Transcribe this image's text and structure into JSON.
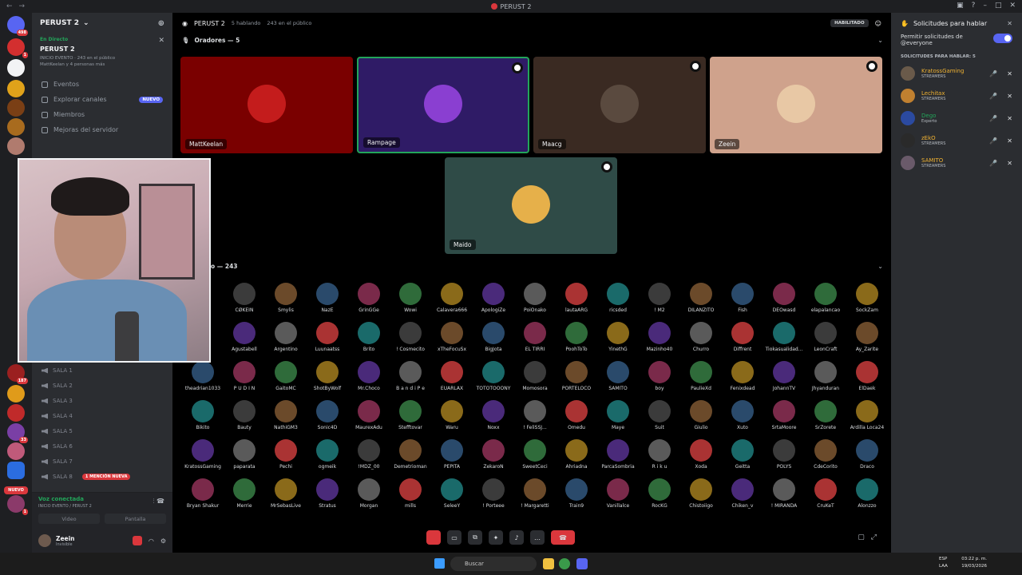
{
  "window": {
    "title": "PERUST 2"
  },
  "server": {
    "name": "PERUST 2",
    "event_status": "En Directo",
    "event_name": "PERUST 2",
    "event_meta": "INICIO EVENTO · 243 en el público",
    "event_people": "MattKeelan y 4 personas más"
  },
  "menu": [
    {
      "label": "Eventos"
    },
    {
      "label": "Explorar canales",
      "badge": "NUEVO"
    },
    {
      "label": "Miembros"
    },
    {
      "label": "Mejoras del servidor"
    }
  ],
  "salas": [
    "SALA 1",
    "SALA 2",
    "SALA 3",
    "SALA 4",
    "SALA 5",
    "SALA 6",
    "SALA 7",
    "SALA 8"
  ],
  "mention_badge": "1 MENCIÓN NUEVA",
  "rail_new": "NUEVO",
  "rail_badges": [
    "498",
    "1",
    "187",
    "33",
    "1"
  ],
  "voice": {
    "status": "Voz conectada",
    "channel": "INICIO EVENTO / PERUST 2",
    "video": "Video",
    "screen": "Pantalla"
  },
  "user": {
    "name": "Zeein",
    "status": "Invisible"
  },
  "stage": {
    "title": "PERUST 2",
    "speaking": "5 hablando",
    "audience_count": "243 en el público",
    "status": "HABILITADO",
    "speakers_label": "Oradores — 5",
    "audience_label": "o — 243"
  },
  "speakers": [
    {
      "name": "MattKeelan",
      "bg": "#7a0000",
      "av": "#c41c1c"
    },
    {
      "name": "Rampage",
      "bg": "#2f1b66",
      "av": "#8a3fd1"
    },
    {
      "name": "Maacg",
      "bg": "#3a2a22",
      "av": "#5a4a3f"
    },
    {
      "name": "Zeein",
      "bg": "#cfa28c",
      "av": "#e8c8a5"
    },
    {
      "name": "Maido",
      "bg": "#2f4b47",
      "av": "#e6b04a"
    }
  ],
  "audience": [
    [
      "CØKEIN",
      "Smylis",
      "NazE",
      "GrinGGe",
      "Wowi",
      "Calavera666",
      "ApologiZe",
      "PoiOnako",
      "lautaARG",
      "ricsded",
      "! M2",
      "DILANZITO",
      "Fish",
      "DEOwasd",
      "elapalancao",
      "SockZam"
    ],
    [
      "Agustabell",
      "Argentino",
      "Luunaatss",
      "Brito",
      "! Cosmecito",
      "xTheFocuSx",
      "BigJota",
      "EL TIRRI",
      "PoohToTo",
      "YinethG",
      "Mazinho40",
      "Churro",
      "Diffrent",
      "Tiokasualidad...",
      "LeonCraft",
      "Ay_Zarite"
    ],
    [
      "theadrian1033",
      "P U D I N",
      "GaitoMC",
      "ShotByWolf",
      "Mr.Choco",
      "B a n d i P e",
      "EUARLAX",
      "TOTOTOOONY",
      "Momosora",
      "PORTELOCO",
      "SAMITO",
      "boy",
      "PaulieXd",
      "Fenixdead",
      "JohannTV",
      "Jhyanduran",
      "ElDaek"
    ],
    [
      "Bikito",
      "Bauty",
      "NathiGM3",
      "Sonic4D",
      "MaurexAdu",
      "Stefftovar",
      "Waru",
      "Noxx",
      "! FeliSSJ...",
      "Omedu",
      "Maye",
      "Suit",
      "Giulio",
      "Xuto",
      "SrtaMoore",
      "SrZorete",
      "Ardilla Loca24"
    ],
    [
      "KratossGaming",
      "paparata",
      "Pechi",
      "ogmeik",
      "!MDZ_00",
      "Demetrioman",
      "PEPITA",
      "ZekaroN",
      "SweetCeci",
      "Ahriadna",
      "ParcaSombria",
      "R i k u",
      "Xoda",
      "Geitta",
      "POLYS",
      "CdeCorito",
      "Draco"
    ],
    [
      "Bryan Shakur",
      "Merrie",
      "MrSebasLive",
      "Stratus",
      "Morgan",
      "mills",
      "SeleeY",
      "! Porteee",
      "! Margaretti",
      "Train9",
      "Vanillalce",
      "RocKG",
      "Chistoiigo",
      "Chiken_v",
      "! MIRANDA",
      "CruKeT",
      "Alonzzo"
    ]
  ],
  "right_panel": {
    "title": "Solicitudes para hablar",
    "toggle_label": "Permitir solicitudes de @everyone",
    "section": "SOLICITUDES PARA HABLAR: 5",
    "requests": [
      {
        "name": "KratossGaming",
        "role": "STREAMERS",
        "color": "#f0b232"
      },
      {
        "name": "Lechitax",
        "role": "STREAMERS",
        "color": "#f0b232"
      },
      {
        "name": "Dego",
        "role": "Experto",
        "color": "#23a55a"
      },
      {
        "name": "zEkO",
        "role": "STREAMERS",
        "color": "#f0b232"
      },
      {
        "name": "SAMITO",
        "role": "STREAMERS",
        "color": "#f0b232"
      }
    ]
  },
  "taskbar": {
    "search": "Buscar",
    "lang": "ESP",
    "lang2": "LAA",
    "time": "03:22 p. m.",
    "date": "19/03/2026"
  }
}
